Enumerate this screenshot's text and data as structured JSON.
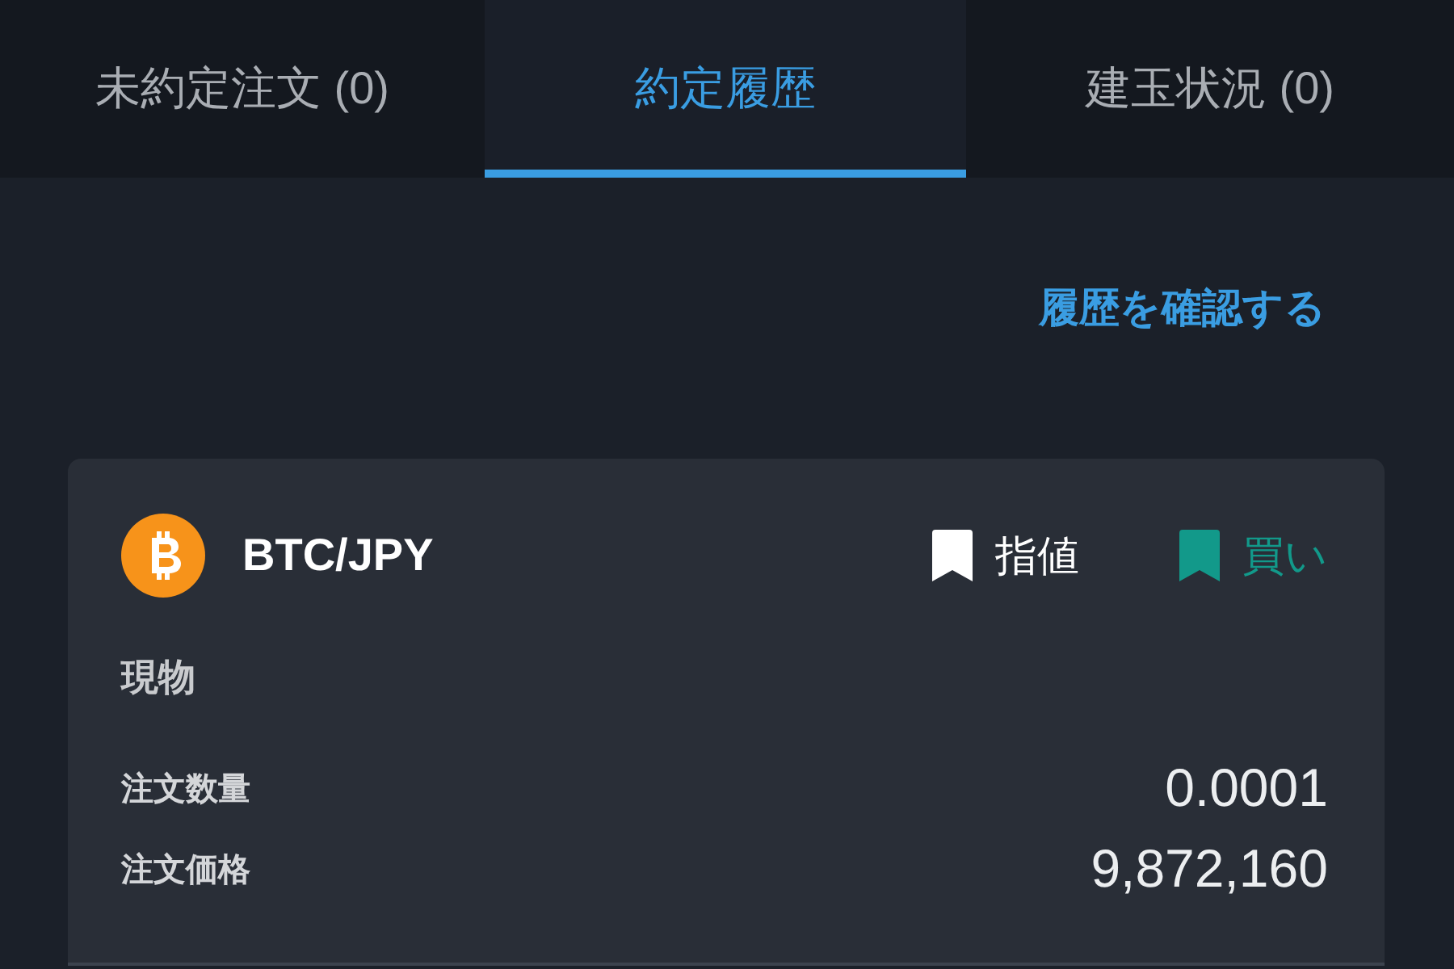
{
  "tabs": [
    {
      "label": "未約定注文 (0)",
      "selected": false
    },
    {
      "label": "約定履歴",
      "selected": true
    },
    {
      "label": "建玉状況 (0)",
      "selected": false
    }
  ],
  "history_link": "履歴を確認する",
  "trade": {
    "pair": "BTC/JPY",
    "tags": [
      {
        "label": "指値",
        "color": "#ffffff"
      },
      {
        "label": "買い",
        "color": "#12998a"
      }
    ],
    "category": "現物",
    "fields": [
      {
        "label": "注文数量",
        "value": "0.0001"
      },
      {
        "label": "注文価格",
        "value": "9,872,160"
      }
    ]
  }
}
